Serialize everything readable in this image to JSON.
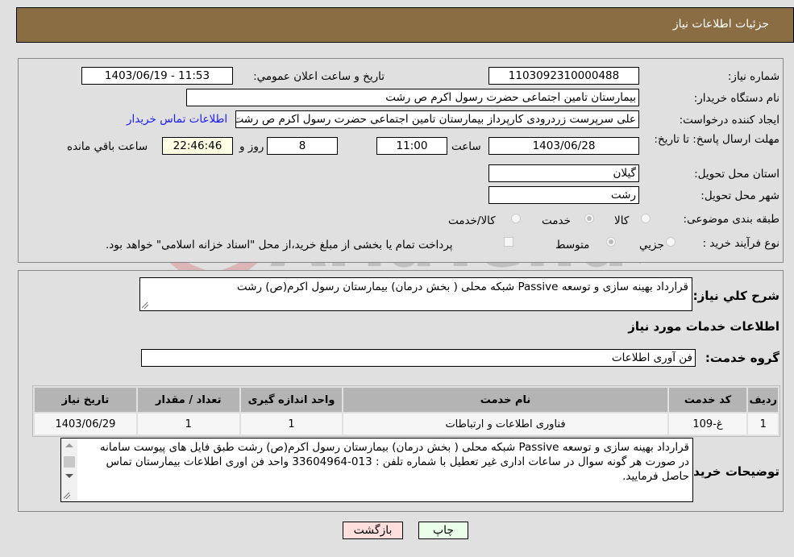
{
  "header": {
    "title": "جزئيات اطلاعات نياز"
  },
  "details": {
    "need_number_label": "شماره نياز:",
    "need_number": "1103092310000488",
    "announce_label": "تاريخ و ساعت اعلان عمومي:",
    "announce_value": "1403/06/19 - 11:53",
    "buyer_org_label": "نام دستگاه خريدار:",
    "buyer_org": "بیمارستان  تامین اجتماعی حضرت رسول اکرم ص رشت",
    "creator_label": "ايجاد کننده درخواست:",
    "creator": "علی سرپرست زردرودی کارپرداز بیمارستان  تامین اجتماعی حضرت رسول اکرم ص رشت",
    "contact_link": "اطلاعات تماس خريدار",
    "deadline_label": "مهلت ارسال پاسخ: تا تاريخ:",
    "deadline_date": "1403/06/28",
    "time_label": "ساعت",
    "deadline_time": "11:00",
    "days_value": "8",
    "days_label": "روز و",
    "remaining_time": "22:46:46",
    "remaining_label": "ساعت باقي مانده",
    "province_label": "استان محل تحويل:",
    "province": "گيلان",
    "city_label": "شهر محل تحويل:",
    "city": "رشت",
    "category_label": "طبقه بندی موضوعی:",
    "category_options": [
      "کالا",
      "خدمت",
      "کالا/خدمت"
    ],
    "category_selected": "خدمت",
    "process_label": "نوع فرآيند خريد :",
    "process_options": [
      "جزيي",
      "متوسط"
    ],
    "process_selected": "متوسط",
    "treasury_note": "پرداخت تمام يا بخشی از مبلغ خريد،از محل \"اسناد خزانه اسلامی\" خواهد بود.",
    "treasury_checked": false
  },
  "summary": {
    "description_label": "شرح كلي نياز:",
    "description": "قرارداد  بهینه سازی و توسعه Passive شبکه محلی ( بخش درمان) بیمارستان رسول اکرم(ص) رشت",
    "services_heading": "اطلاعات خدمات مورد نياز",
    "service_group_label": "گروه خدمت:",
    "service_group": "فن آوری اطلاعات"
  },
  "table": {
    "headers": [
      "رديف",
      "کد خدمت",
      "نام خدمت",
      "واحد اندازه گيری",
      "تعداد / مقدار",
      "تاريخ نياز"
    ],
    "rows": [
      [
        "1",
        "غ-109",
        "فناوری اطلاعات و ارتباطات",
        "1",
        "1",
        "1403/06/29"
      ]
    ]
  },
  "buyer_notes": {
    "label": "توضيحات خريدار:",
    "lines": [
      "قرارداد  بهینه سازی و توسعه Passive شبکه محلی ( بخش درمان) بیمارستان رسول اکرم(ص) رشت  طبق فایل های پیوست سامانه",
      "در صورت هر گونه سوال در ساعات اداری غیر تعطیل با شماره تلفن : 013-33604964 واحد فن اوری اطلاعات بیمارستان تماس حاصل فرمایید."
    ]
  },
  "buttons": {
    "print": "چاپ",
    "back": "بازگشت"
  },
  "watermark": {
    "text": "AriaTender.neT"
  }
}
